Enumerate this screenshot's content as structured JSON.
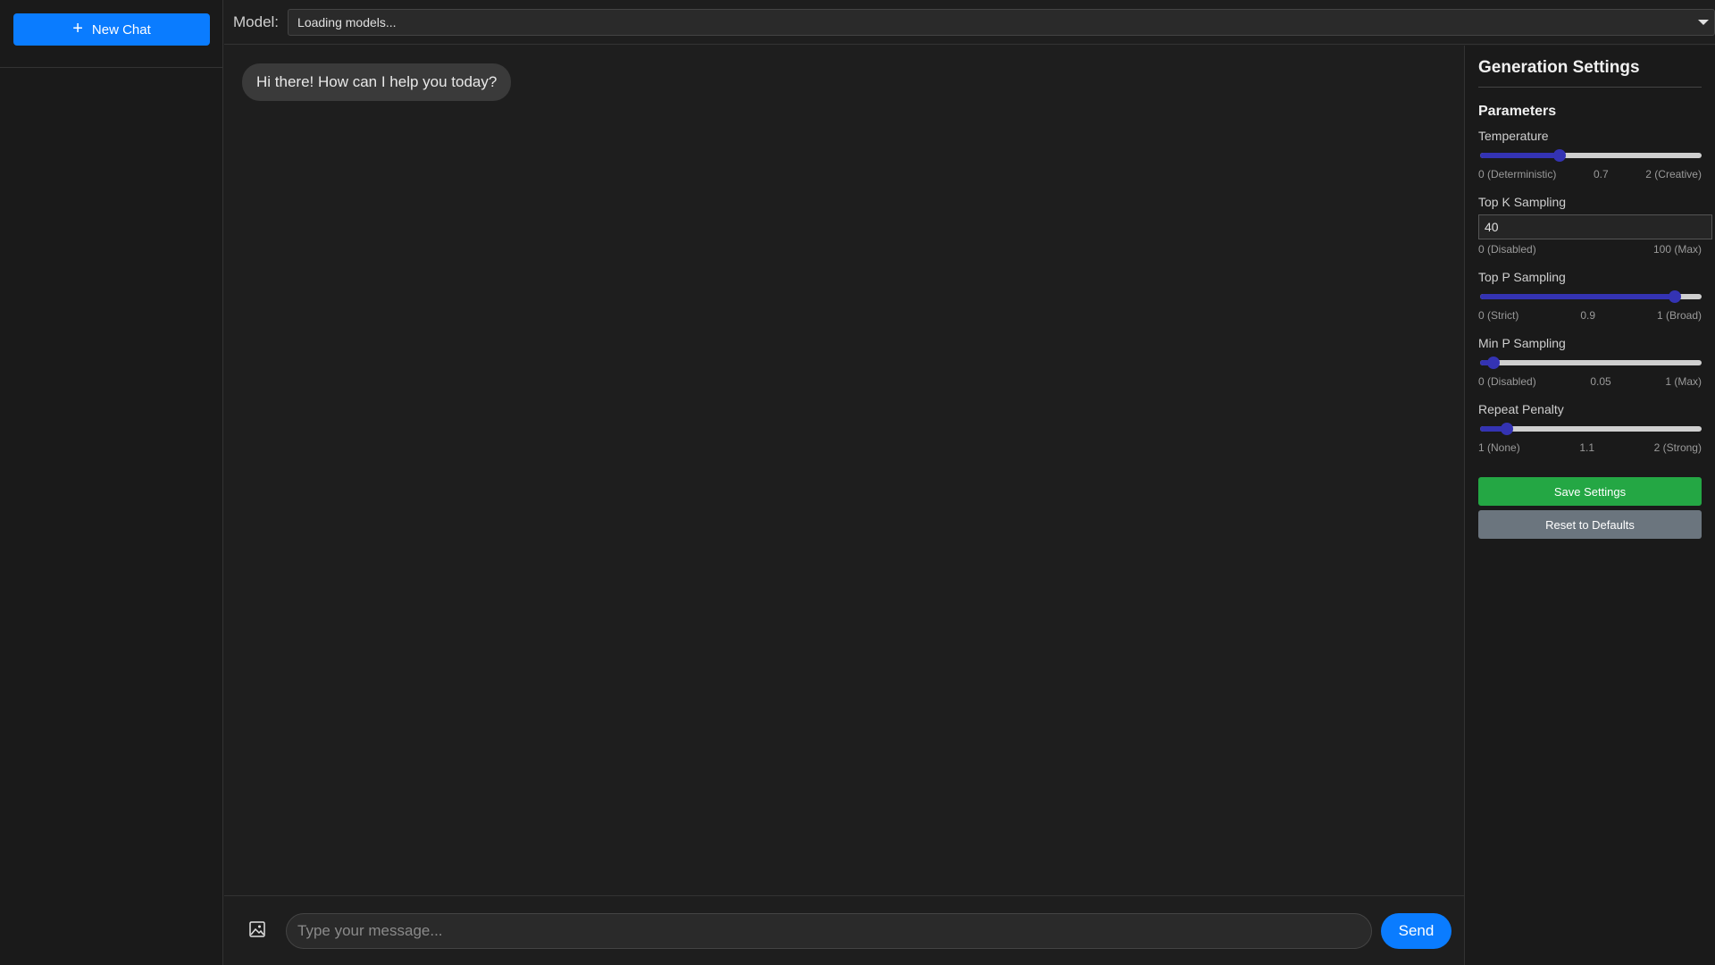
{
  "sidebar": {
    "new_chat_label": "New Chat"
  },
  "header": {
    "model_label": "Model:",
    "model_select_value": "Loading models..."
  },
  "chat": {
    "messages": [
      {
        "role": "assistant",
        "text": "Hi there! How can I help you today?"
      }
    ]
  },
  "composer": {
    "placeholder": "Type your message...",
    "send_label": "Send"
  },
  "settings": {
    "title": "Generation Settings",
    "section": "Parameters",
    "temperature": {
      "label": "Temperature",
      "min_label": "0 (Deterministic)",
      "value_label": "0.7",
      "max_label": "2 (Creative)",
      "fraction": 0.36
    },
    "top_k": {
      "label": "Top K Sampling",
      "value": "40",
      "min_label": "0 (Disabled)",
      "max_label": "100 (Max)"
    },
    "top_p": {
      "label": "Top P Sampling",
      "min_label": "0 (Strict)",
      "value_label": "0.9",
      "max_label": "1 (Broad)",
      "fraction": 0.88
    },
    "min_p": {
      "label": "Min P Sampling",
      "min_label": "0 (Disabled)",
      "value_label": "0.05",
      "max_label": "1 (Max)",
      "fraction": 0.06
    },
    "repeat_penalty": {
      "label": "Repeat Penalty",
      "min_label": "1 (None)",
      "value_label": "1.1",
      "max_label": "2 (Strong)",
      "fraction": 0.12
    },
    "save_label": "Save Settings",
    "reset_label": "Reset to Defaults"
  },
  "colors": {
    "accent": "#0a7cff",
    "slider": "#3433b3",
    "save": "#24a744",
    "reset": "#6b757e"
  }
}
